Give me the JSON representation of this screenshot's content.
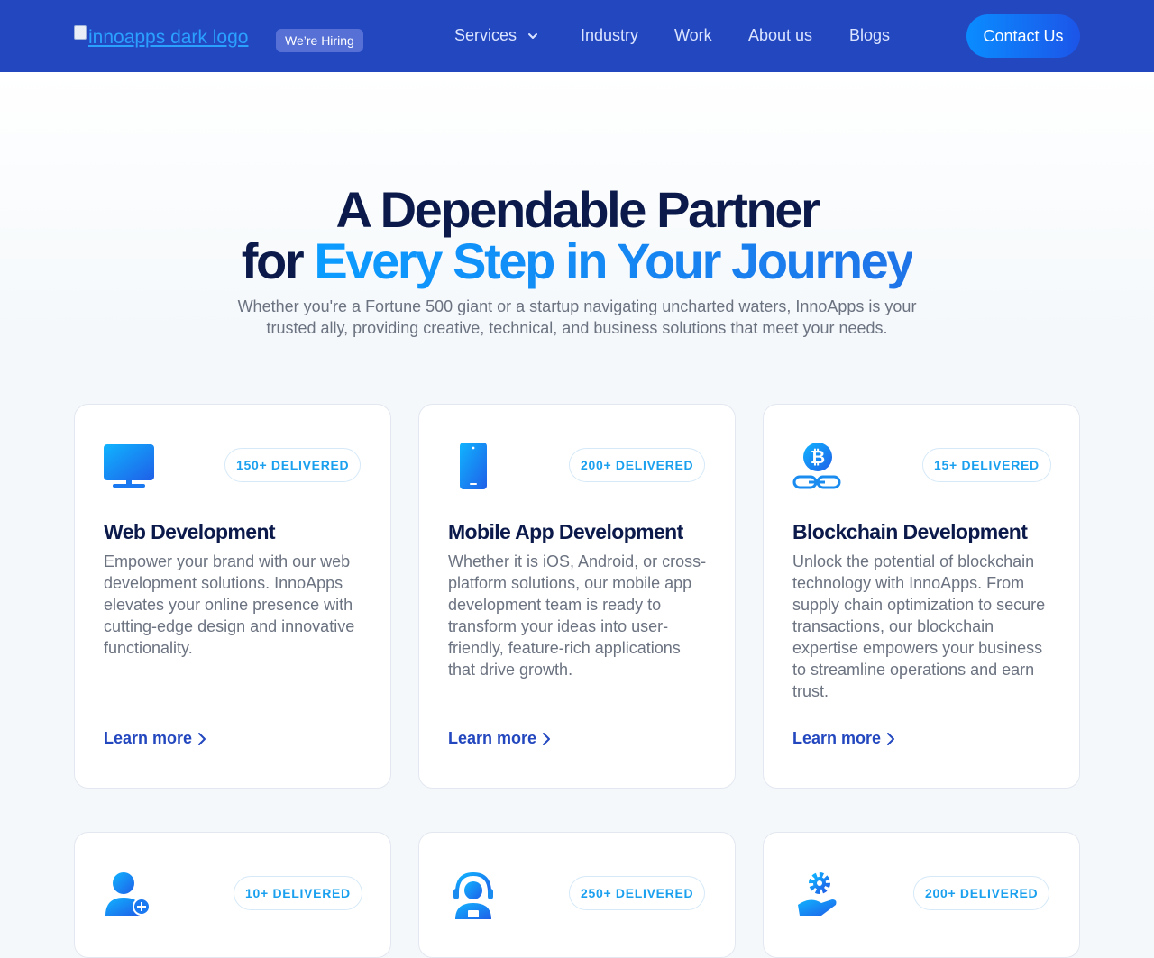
{
  "nav": {
    "logo_alt": "innoapps dark logo",
    "hiring_badge": "We’re Hiring",
    "items": [
      "Services",
      "Industry",
      "Work",
      "About us",
      "Blogs"
    ],
    "contact_label": "Contact Us"
  },
  "hero": {
    "title_line1": "A Dependable Partner",
    "title_line2_prefix": "for ",
    "title_line2_highlight": "Every Step in Your Journey",
    "subtitle_line1": "Whether you're a Fortune 500 giant or a startup navigating uncharted waters, InnoApps is your",
    "subtitle_line2": "trusted ally, providing creative, technical, and business solutions that meet your needs."
  },
  "cards": [
    {
      "icon": "monitor-icon",
      "badge": "150+ DELIVERED",
      "title": "Web Development",
      "description": "Empower your brand with our web development solutions. InnoApps elevates your online presence with cutting-edge design and innovative functionality.",
      "link": "Learn more"
    },
    {
      "icon": "smartphone-icon",
      "badge": "200+ DELIVERED",
      "title": "Mobile App Development",
      "description": "Whether it is iOS, Android, or cross-platform solutions, our mobile app development team is ready to transform your ideas into user-friendly, feature-rich applications that drive growth.",
      "link": "Learn more"
    },
    {
      "icon": "bitcoin-chain-icon",
      "badge": "15+ DELIVERED",
      "title": "Blockchain Development",
      "description": "Unlock the potential of blockchain technology with InnoApps. From supply chain optimization to secure transactions, our blockchain expertise empowers your business to streamline operations and earn trust.",
      "link": "Learn more"
    },
    {
      "icon": "user-add-icon",
      "badge": "10+ DELIVERED"
    },
    {
      "icon": "support-agent-icon",
      "badge": "250+ DELIVERED"
    },
    {
      "icon": "hand-gear-icon",
      "badge": "200+ DELIVERED"
    }
  ],
  "colors": {
    "nav_bg": "#2347bf",
    "accent_blue": "#0b9cff",
    "title_navy": "#0b1a4a",
    "link_blue": "#2347bf"
  }
}
